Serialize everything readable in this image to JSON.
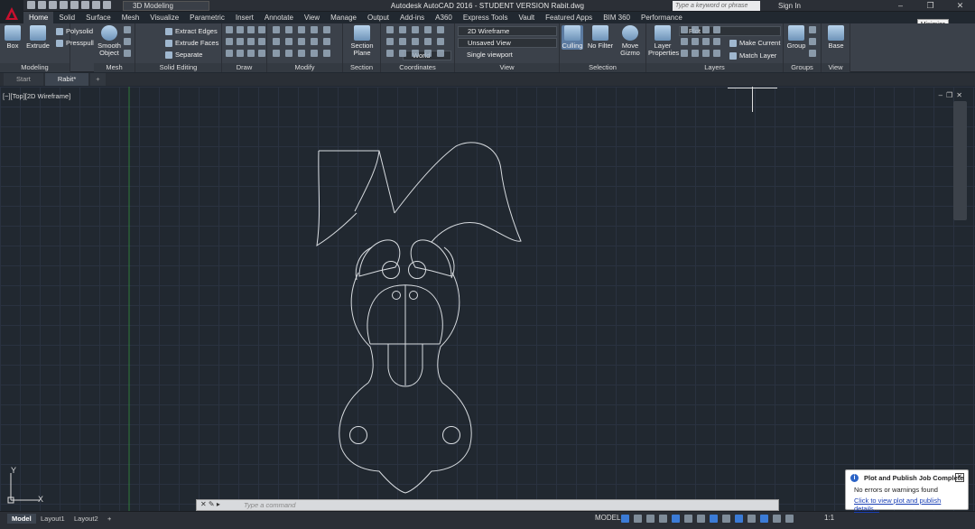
{
  "app": {
    "title": "Autodesk AutoCAD 2016 - STUDENT VERSION   Rabit.dwg",
    "workspace": "3D Modeling",
    "search_placeholder": "Type a keyword or phrase",
    "sign_in": "Sign In",
    "tooltip": "Minimize"
  },
  "ribbon_tabs": [
    "Home",
    "Solid",
    "Surface",
    "Mesh",
    "Visualize",
    "Parametric",
    "Insert",
    "Annotate",
    "View",
    "Manage",
    "Output",
    "Add-ins",
    "A360",
    "Express Tools",
    "Vault",
    "Featured Apps",
    "BIM 360",
    "Performance"
  ],
  "ribbon": {
    "modeling": {
      "label": "Modeling",
      "box": "Box",
      "extrude": "Extrude",
      "polysolid": "Polysolid",
      "presspull": "Presspull"
    },
    "mesh": {
      "label": "Mesh",
      "smooth": "Smooth Object"
    },
    "solid_editing": {
      "label": "Solid Editing",
      "extract_edges": "Extract Edges",
      "extrude_faces": "Extrude Faces",
      "separate": "Separate"
    },
    "draw": {
      "label": "Draw"
    },
    "modify": {
      "label": "Modify"
    },
    "section": {
      "label": "Section",
      "section_plane": "Section Plane"
    },
    "coordinates": {
      "label": "Coordinates",
      "world": "World"
    },
    "view": {
      "label": "View",
      "visual_style": "2D Wireframe",
      "named_view": "Unsaved View",
      "viewport": "Single viewport"
    },
    "selection": {
      "label": "Selection",
      "culling": "Culling",
      "no_filter": "No Filter",
      "move_gizmo": "Move Gizmo"
    },
    "layers": {
      "label": "Layers",
      "layer_properties": "Layer Properties",
      "layer_name": "Plot",
      "make_current": "Make Current",
      "match_layer": "Match Layer"
    },
    "groups": {
      "label": "Groups",
      "group": "Group"
    },
    "viewpanel": {
      "label": "View",
      "base": "Base"
    }
  },
  "file_tabs": [
    "Start",
    "Rabit*"
  ],
  "viewport": {
    "label": "[−][Top][2D Wireframe]"
  },
  "command": {
    "placeholder": "Type a command"
  },
  "layout_tabs": [
    "Model",
    "Layout1",
    "Layout2"
  ],
  "status": {
    "model": "MODEL",
    "scale": "1:1"
  },
  "notification": {
    "title": "Plot and Publish Job Complete",
    "body": "No errors or warnings found",
    "link": "Click to view plot and publish details..."
  },
  "ucs": {
    "x": "X",
    "y": "Y"
  },
  "colors": {
    "background": "#212830",
    "grid": "#2a3240",
    "ribbon": "#3b414a",
    "accent": "#3b7bd6"
  }
}
